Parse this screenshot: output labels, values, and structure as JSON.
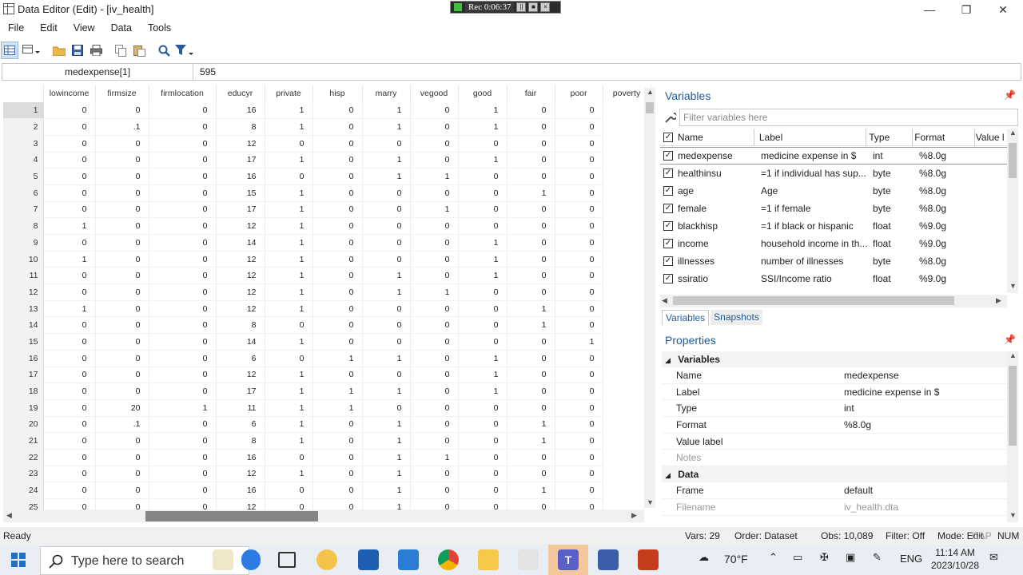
{
  "window": {
    "title": "Data Editor (Edit) - [iv_health]",
    "rec_timer": "Rec 0:06:37"
  },
  "menu": [
    "File",
    "Edit",
    "View",
    "Data",
    "Tools"
  ],
  "cellbar": {
    "name": "medexpense[1]",
    "value": "595"
  },
  "grid": {
    "columns": [
      "lowincome",
      "firmsize",
      "firmlocation",
      "educyr",
      "private",
      "hisp",
      "marry",
      "vegood",
      "good",
      "fair",
      "poor",
      "poverty"
    ],
    "rows": [
      [
        "1",
        "0",
        "0",
        "0",
        "16",
        "1",
        "0",
        "1",
        "0",
        "1",
        "0",
        "0"
      ],
      [
        "2",
        "0",
        ".1",
        "0",
        "8",
        "1",
        "0",
        "1",
        "0",
        "1",
        "0",
        "0"
      ],
      [
        "3",
        "0",
        "0",
        "0",
        "12",
        "0",
        "0",
        "0",
        "0",
        "0",
        "0",
        "0"
      ],
      [
        "4",
        "0",
        "0",
        "0",
        "17",
        "1",
        "0",
        "1",
        "0",
        "1",
        "0",
        "0"
      ],
      [
        "5",
        "0",
        "0",
        "0",
        "16",
        "0",
        "0",
        "1",
        "1",
        "0",
        "0",
        "0"
      ],
      [
        "6",
        "0",
        "0",
        "0",
        "15",
        "1",
        "0",
        "0",
        "0",
        "0",
        "1",
        "0"
      ],
      [
        "7",
        "0",
        "0",
        "0",
        "17",
        "1",
        "0",
        "0",
        "1",
        "0",
        "0",
        "0"
      ],
      [
        "8",
        "1",
        "0",
        "0",
        "12",
        "1",
        "0",
        "0",
        "0",
        "0",
        "0",
        "0"
      ],
      [
        "9",
        "0",
        "0",
        "0",
        "14",
        "1",
        "0",
        "0",
        "0",
        "1",
        "0",
        "0"
      ],
      [
        "10",
        "1",
        "0",
        "0",
        "12",
        "1",
        "0",
        "0",
        "0",
        "1",
        "0",
        "0"
      ],
      [
        "11",
        "0",
        "0",
        "0",
        "12",
        "1",
        "0",
        "1",
        "0",
        "1",
        "0",
        "0"
      ],
      [
        "12",
        "0",
        "0",
        "0",
        "12",
        "1",
        "0",
        "1",
        "1",
        "0",
        "0",
        "0"
      ],
      [
        "13",
        "1",
        "0",
        "0",
        "12",
        "1",
        "0",
        "0",
        "0",
        "0",
        "1",
        "0"
      ],
      [
        "14",
        "0",
        "0",
        "0",
        "8",
        "0",
        "0",
        "0",
        "0",
        "0",
        "1",
        "0"
      ],
      [
        "15",
        "0",
        "0",
        "0",
        "14",
        "1",
        "0",
        "0",
        "0",
        "0",
        "0",
        "1"
      ],
      [
        "16",
        "0",
        "0",
        "0",
        "6",
        "0",
        "1",
        "1",
        "0",
        "1",
        "0",
        "0"
      ],
      [
        "17",
        "0",
        "0",
        "0",
        "12",
        "1",
        "0",
        "0",
        "0",
        "1",
        "0",
        "0"
      ],
      [
        "18",
        "0",
        "0",
        "0",
        "17",
        "1",
        "1",
        "1",
        "0",
        "1",
        "0",
        "0"
      ],
      [
        "19",
        "0",
        "20",
        "1",
        "11",
        "1",
        "1",
        "0",
        "0",
        "0",
        "0",
        "0"
      ],
      [
        "20",
        "0",
        ".1",
        "0",
        "6",
        "1",
        "0",
        "1",
        "0",
        "0",
        "1",
        "0"
      ],
      [
        "21",
        "0",
        "0",
        "0",
        "8",
        "1",
        "0",
        "1",
        "0",
        "0",
        "1",
        "0"
      ],
      [
        "22",
        "0",
        "0",
        "0",
        "16",
        "0",
        "0",
        "1",
        "1",
        "0",
        "0",
        "0"
      ],
      [
        "23",
        "0",
        "0",
        "0",
        "12",
        "1",
        "0",
        "1",
        "0",
        "0",
        "0",
        "0"
      ],
      [
        "24",
        "0",
        "0",
        "0",
        "16",
        "0",
        "0",
        "1",
        "0",
        "0",
        "1",
        "0"
      ],
      [
        "25",
        "0",
        "0",
        "0",
        "12",
        "0",
        "0",
        "1",
        "0",
        "0",
        "0",
        "0"
      ]
    ]
  },
  "variables_panel": {
    "title": "Variables",
    "filter_placeholder": "Filter variables here",
    "headers": {
      "name": "Name",
      "label": "Label",
      "type": "Type",
      "format": "Format",
      "value_label": "Value l"
    },
    "rows": [
      {
        "name": "medexpense",
        "label": "medicine expense in $",
        "type": "int",
        "format": "%8.0g"
      },
      {
        "name": "healthinsu",
        "label": "=1 if individual has sup...",
        "type": "byte",
        "format": "%8.0g"
      },
      {
        "name": "age",
        "label": "Age",
        "type": "byte",
        "format": "%8.0g"
      },
      {
        "name": "female",
        "label": "=1 if female",
        "type": "byte",
        "format": "%8.0g"
      },
      {
        "name": "blackhisp",
        "label": "=1 if black or hispanic",
        "type": "float",
        "format": "%9.0g"
      },
      {
        "name": "income",
        "label": "household income in th...",
        "type": "float",
        "format": "%9.0g"
      },
      {
        "name": "illnesses",
        "label": "number of illnesses",
        "type": "byte",
        "format": "%8.0g"
      },
      {
        "name": "ssiratio",
        "label": "SSI/Income ratio",
        "type": "float",
        "format": "%9.0g"
      }
    ],
    "tabs": [
      "Variables",
      "Snapshots"
    ]
  },
  "properties_panel": {
    "title": "Properties",
    "groups": [
      {
        "name": "Variables",
        "rows": [
          {
            "key": "Name",
            "value": "medexpense"
          },
          {
            "key": "Label",
            "value": "medicine expense in $"
          },
          {
            "key": "Type",
            "value": "int"
          },
          {
            "key": "Format",
            "value": "%8.0g"
          },
          {
            "key": "Value label",
            "value": ""
          },
          {
            "key": "Notes",
            "value": ""
          }
        ]
      },
      {
        "name": "Data",
        "rows": [
          {
            "key": "Frame",
            "value": "default"
          },
          {
            "key": "Filename",
            "value": "iv_health.dta"
          }
        ]
      }
    ]
  },
  "status": {
    "ready": "Ready",
    "vars": "Vars: 29",
    "order": "Order: Dataset",
    "obs": "Obs: 10,089",
    "filter": "Filter: Off",
    "mode": "Mode: Edit",
    "cap": "CAP",
    "num": "NUM"
  },
  "taskbar": {
    "search_placeholder": "Type here to search",
    "weather": "70°F",
    "language": "ENG",
    "time": "11:14 AM",
    "date": "2023/10/28"
  }
}
